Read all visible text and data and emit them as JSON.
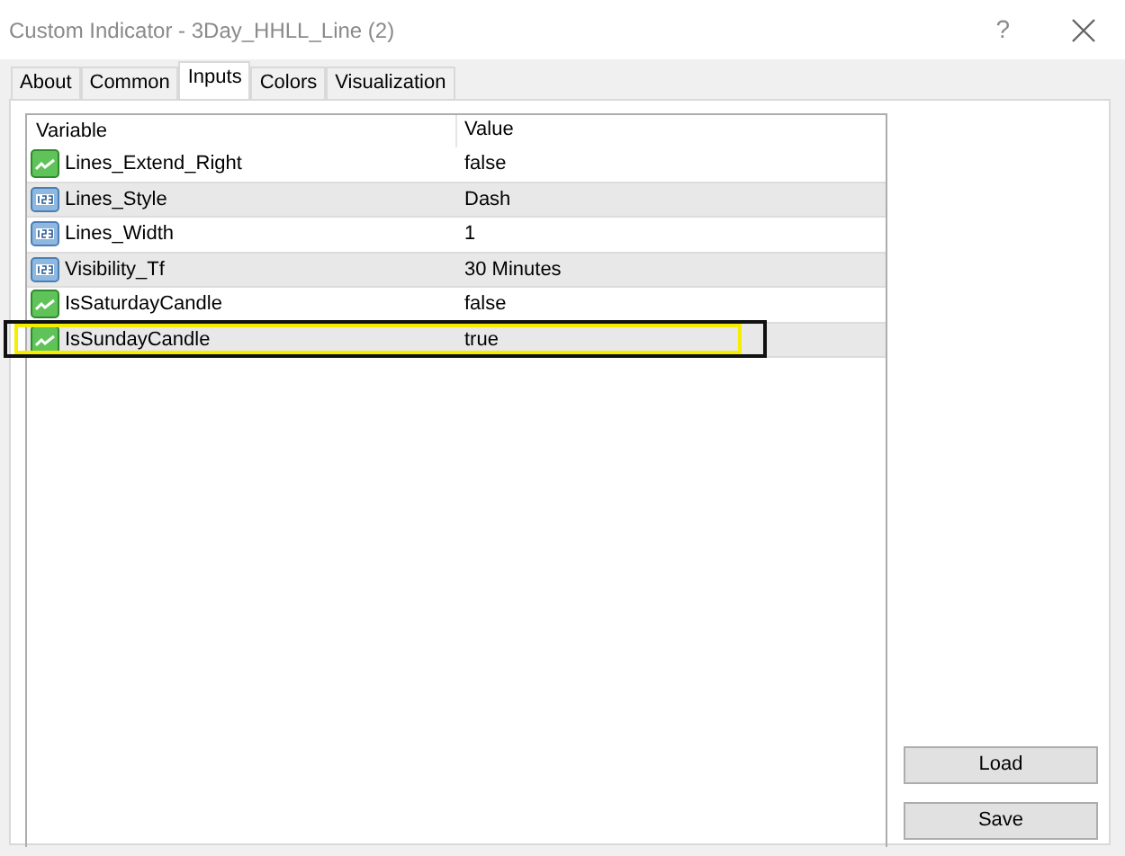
{
  "window": {
    "title": "Custom Indicator - 3Day_HHLL_Line (2)",
    "help": "?"
  },
  "tabs": [
    {
      "label": "About",
      "selected": false
    },
    {
      "label": "Common",
      "selected": false
    },
    {
      "label": "Inputs",
      "selected": true
    },
    {
      "label": "Colors",
      "selected": false
    },
    {
      "label": "Visualization",
      "selected": false
    }
  ],
  "table": {
    "columns": [
      "Variable",
      "Value"
    ],
    "rows": [
      {
        "kind": "bool",
        "variable": "Lines_Extend_Right",
        "value": "false",
        "highlighted": false
      },
      {
        "kind": "number",
        "variable": "Lines_Style",
        "value": "Dash",
        "highlighted": false
      },
      {
        "kind": "number",
        "variable": "Lines_Width",
        "value": "1",
        "highlighted": false
      },
      {
        "kind": "number",
        "variable": "Visibility_Tf",
        "value": "30 Minutes",
        "highlighted": false
      },
      {
        "kind": "bool",
        "variable": "IsSaturdayCandle",
        "value": "false",
        "highlighted": false
      },
      {
        "kind": "bool",
        "variable": "IsSundayCandle",
        "value": "true",
        "highlighted": true
      }
    ]
  },
  "buttons": [
    "Load",
    "Save"
  ]
}
